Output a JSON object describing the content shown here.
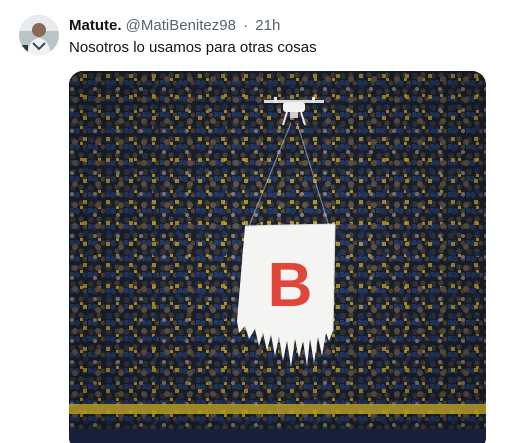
{
  "tweet": {
    "display_name": "Matute.",
    "handle": "@MatiBenitez98",
    "separator": "·",
    "time": "21h",
    "text": "Nosotros lo usamos para otras cosas",
    "media": {
      "icon": "photo-icon",
      "flag_letter": "B",
      "flag_letter_color": "#e2463a"
    }
  },
  "colors": {
    "name": "#0f1419",
    "secondary": "#536471",
    "background": "#ffffff"
  }
}
